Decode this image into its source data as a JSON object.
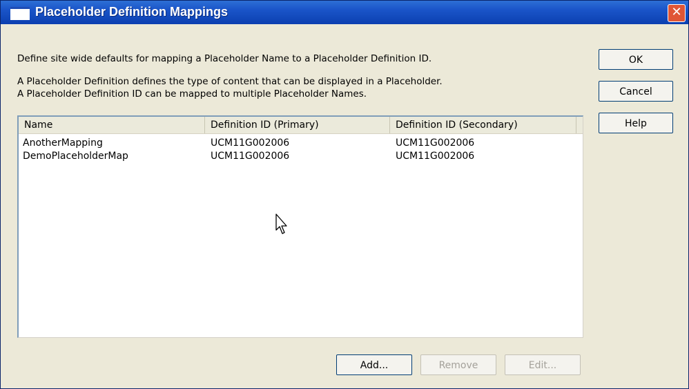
{
  "window": {
    "title": "Placeholder Definition Mappings",
    "close_glyph": "✕"
  },
  "description": {
    "line1": "Define site wide defaults for mapping a Placeholder Name to a Placeholder Definition ID.",
    "line2": "A Placeholder Definition defines the type of content that can be displayed in a Placeholder.",
    "line3": "A Placeholder Definition ID can be mapped to multiple Placeholder Names."
  },
  "side_buttons": {
    "ok": "OK",
    "cancel": "Cancel",
    "help": "Help"
  },
  "table": {
    "columns": [
      "Name",
      "Definition ID (Primary)",
      "Definition ID (Secondary)"
    ],
    "rows": [
      [
        "AnotherMapping",
        "UCM11G002006",
        "UCM11G002006"
      ],
      [
        "DemoPlaceholderMap",
        "UCM11G002006",
        "UCM11G002006"
      ]
    ]
  },
  "bottom_buttons": {
    "add": "Add...",
    "remove": "Remove",
    "edit": "Edit..."
  },
  "colors": {
    "titlebar": "#0b3fb0",
    "window_bg": "#ece9d8",
    "close": "#e05636"
  },
  "icons": {
    "window": "window-icon",
    "close": "close-icon",
    "cursor": "mouse-pointer-icon"
  }
}
